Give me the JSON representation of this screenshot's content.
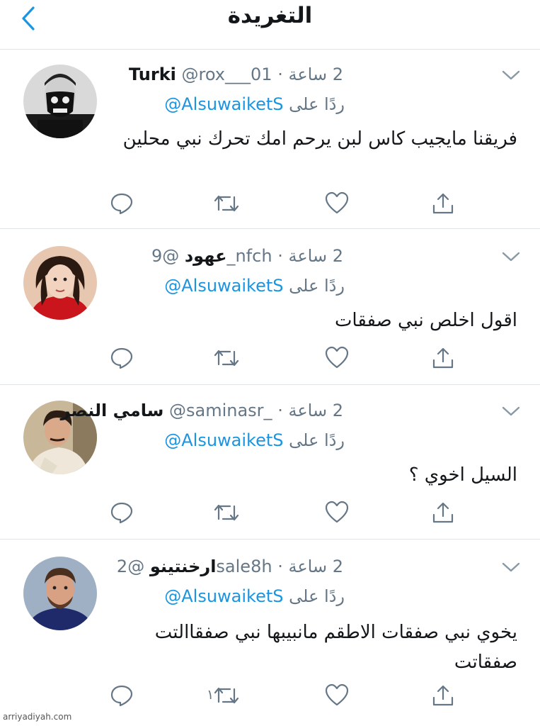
{
  "header": {
    "title": "التغريدة",
    "back_icon": "chevron-left-icon",
    "accent": "#1b95e0"
  },
  "tweets": [
    {
      "display_name": "Turki",
      "handle": "@rox___01",
      "time": "2 ساعة",
      "reply_prefix": "ردًا على",
      "reply_to": "@AlsuwaiketS",
      "body": "فريقنا مايجيب كاس لبن يرحم امك تحرك نبي محلين",
      "retweet_count": ""
    },
    {
      "display_name": "عهود",
      "handle": "@9_nfch",
      "time": "2 ساعة",
      "reply_prefix": "ردًا على",
      "reply_to": "@AlsuwaiketS",
      "body": "اقول اخلص نبي صفقات",
      "retweet_count": ""
    },
    {
      "display_name": "سامي النصر",
      "handle": "@saminasr_",
      "time": "2 ساعة",
      "reply_prefix": "ردًا على",
      "reply_to": "@AlsuwaiketS",
      "body": "السيل اخوي ؟",
      "retweet_count": ""
    },
    {
      "display_name": "ارخنتينو",
      "handle": "@2sale8h",
      "time": "2 ساعة",
      "reply_prefix": "ردًا على",
      "reply_to": "@AlsuwaiketS",
      "body": "يخوي نبي صفقات الاطقم مانبيبها نبي صفقاالتت صفقاتت",
      "retweet_count": "١"
    }
  ],
  "footer": {
    "watermark": "arriyadiyah.com"
  },
  "icons": {
    "reply": "reply-bubble-icon",
    "retweet": "retweet-icon",
    "like": "heart-icon",
    "share": "share-icon",
    "more": "chevron-down-icon"
  },
  "colors": {
    "text": "#14171a",
    "muted": "#657786",
    "link": "#1b95e0",
    "divider": "#dfe3e6"
  }
}
